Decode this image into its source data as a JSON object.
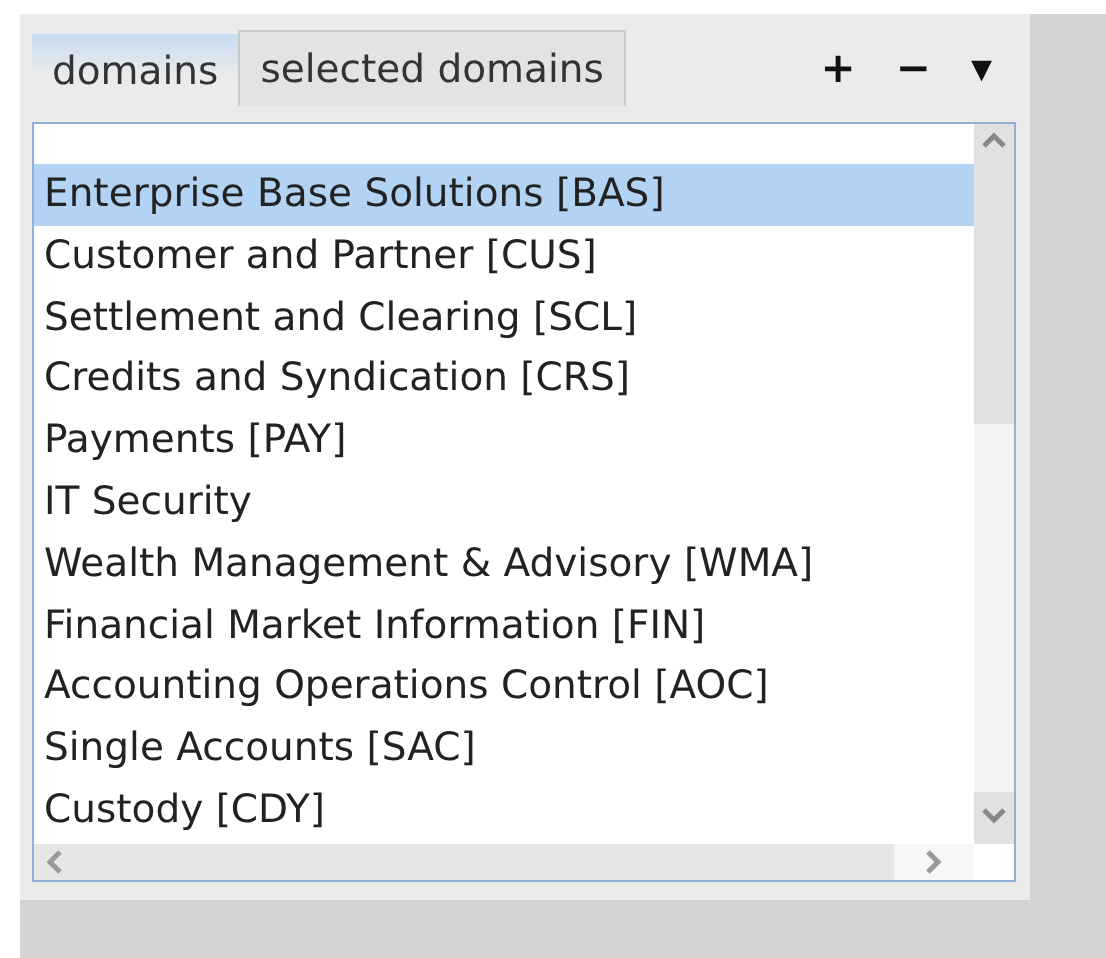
{
  "tabs": [
    {
      "label": "domains",
      "selected": true
    },
    {
      "label": "selected domains",
      "selected": false
    }
  ],
  "toolbar": [
    "+",
    "−",
    "▾"
  ],
  "list": {
    "items": [
      {
        "label": "Enterprise Base Solutions [BAS]",
        "selected": true
      },
      {
        "label": "Customer and Partner [CUS]",
        "selected": false
      },
      {
        "label": "Settlement and Clearing [SCL]",
        "selected": false
      },
      {
        "label": "Credits and Syndication [CRS]",
        "selected": false
      },
      {
        "label": "Payments [PAY]",
        "selected": false
      },
      {
        "label": "IT Security",
        "selected": false
      },
      {
        "label": "Wealth Management & Advisory [WMA]",
        "selected": false
      },
      {
        "label": "Financial Market Information [FIN]",
        "selected": false
      },
      {
        "label": "Accounting Operations Control [AOC]",
        "selected": false
      },
      {
        "label": "Single Accounts [SAC]",
        "selected": false
      },
      {
        "label": "Custody [CDY]",
        "selected": false
      }
    ]
  }
}
